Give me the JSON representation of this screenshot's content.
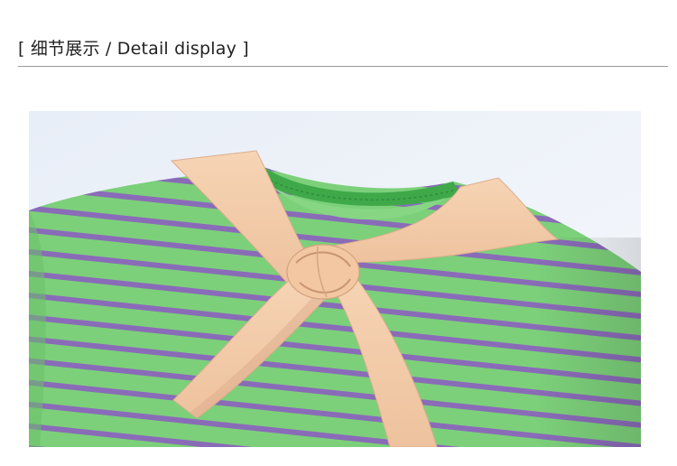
{
  "header": {
    "title": "[ 细节展示 / Detail display ]"
  },
  "photo": {
    "subject": "green-purple-striped-shirt-with-peach-tie",
    "colors": {
      "backdrop": "#eef2f8",
      "shirt_green": "#7cd07a",
      "stripe_purple": "#8a6bb8",
      "tie_peach": "#f3cba8",
      "tie_shadow": "#d9a98a",
      "divider": "#9a9a9a"
    }
  }
}
